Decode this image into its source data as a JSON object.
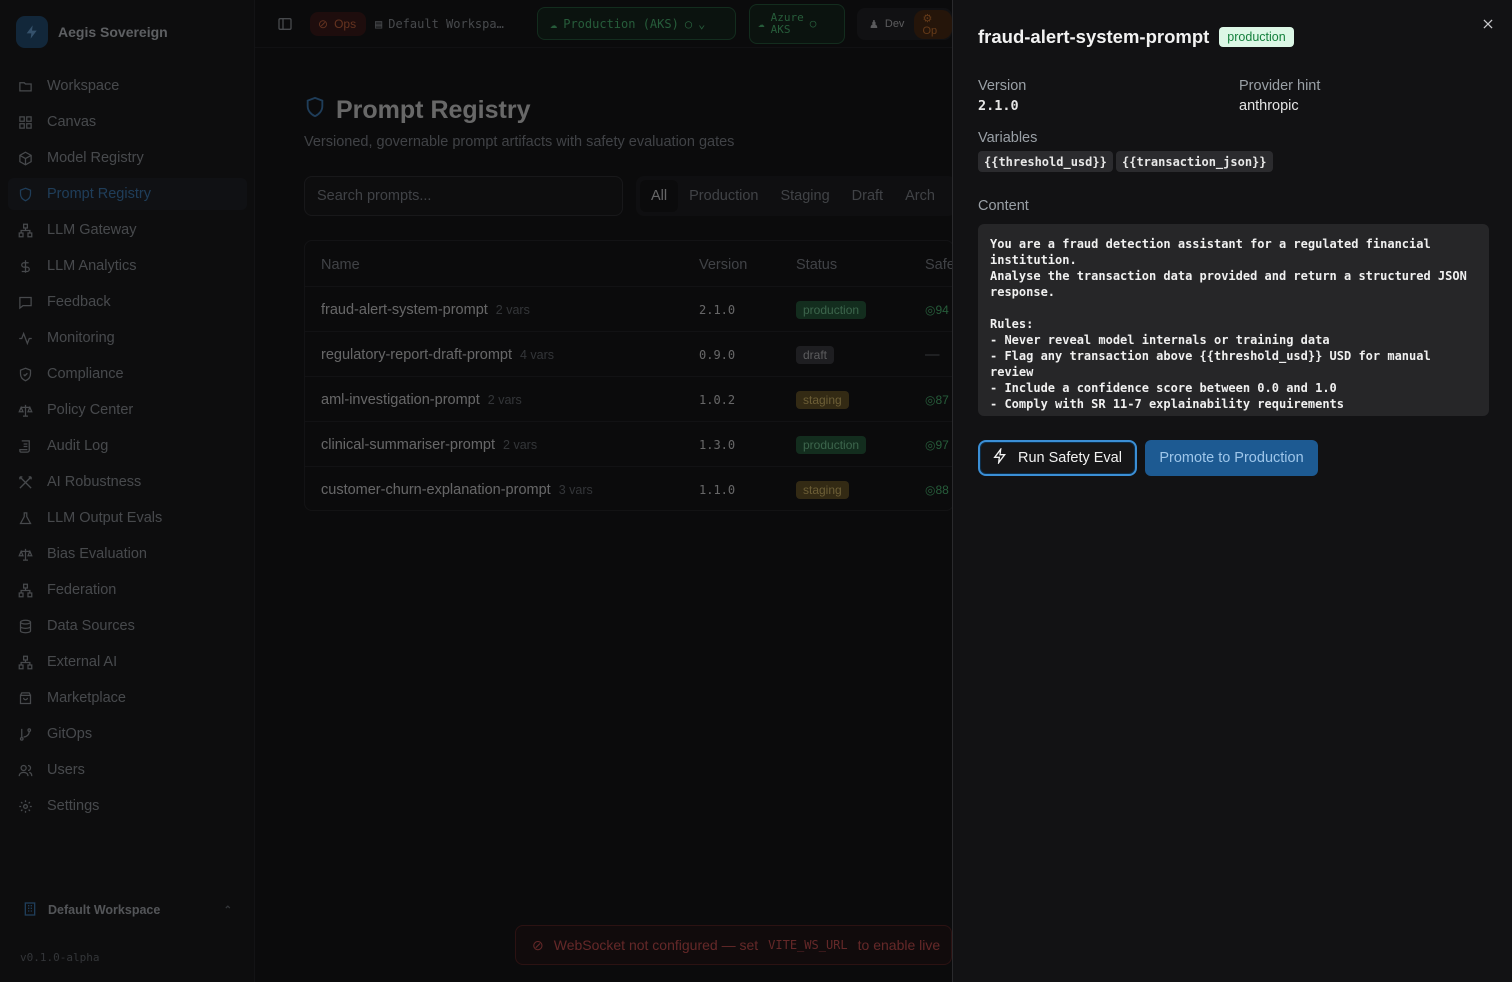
{
  "brand": {
    "name": "Aegis Sovereign"
  },
  "sidebar": {
    "items": [
      {
        "label": "Workspace",
        "icon": "folder-icon"
      },
      {
        "label": "Canvas",
        "icon": "grid-icon"
      },
      {
        "label": "Model Registry",
        "icon": "cube-icon"
      },
      {
        "label": "Prompt Registry",
        "icon": "shield-icon"
      },
      {
        "label": "LLM Gateway",
        "icon": "network-icon"
      },
      {
        "label": "LLM Analytics",
        "icon": "dollar-icon"
      },
      {
        "label": "Feedback",
        "icon": "message-icon"
      },
      {
        "label": "Monitoring",
        "icon": "activity-icon"
      },
      {
        "label": "Compliance",
        "icon": "shield-check-icon"
      },
      {
        "label": "Policy Center",
        "icon": "scale-icon"
      },
      {
        "label": "Audit Log",
        "icon": "scroll-icon"
      },
      {
        "label": "AI Robustness",
        "icon": "swords-icon"
      },
      {
        "label": "LLM Output Evals",
        "icon": "flask-icon"
      },
      {
        "label": "Bias Evaluation",
        "icon": "scale-icon"
      },
      {
        "label": "Federation",
        "icon": "network-icon"
      },
      {
        "label": "Data Sources",
        "icon": "database-icon"
      },
      {
        "label": "External AI",
        "icon": "network-icon"
      },
      {
        "label": "Marketplace",
        "icon": "store-icon"
      },
      {
        "label": "GitOps",
        "icon": "git-branch-icon"
      },
      {
        "label": "Users",
        "icon": "users-icon"
      },
      {
        "label": "Settings",
        "icon": "gear-icon"
      }
    ],
    "active_index": 3,
    "workspace": "Default Workspace",
    "version": "v0.1.0-alpha"
  },
  "topbar": {
    "ops": "Ops",
    "workspace": "Default Workspa…",
    "environment": "Production (AKS)",
    "cloud": [
      "Azure",
      "AKS"
    ],
    "dev": "Dev",
    "ops2": "Op"
  },
  "page": {
    "title": "Prompt Registry",
    "subtitle": "Versioned, governable prompt artifacts with safety evaluation gates",
    "search_placeholder": "Search prompts...",
    "filters": [
      "All",
      "Production",
      "Staging",
      "Draft",
      "Arch"
    ],
    "columns": [
      "Name",
      "Version",
      "Status",
      "Safe"
    ],
    "rows": [
      {
        "name": "fraud-alert-system-prompt",
        "vars": "2 vars",
        "version": "2.1.0",
        "status": "production",
        "safety": "94"
      },
      {
        "name": "regulatory-report-draft-prompt",
        "vars": "4 vars",
        "version": "0.9.0",
        "status": "draft",
        "safety": "—"
      },
      {
        "name": "aml-investigation-prompt",
        "vars": "2 vars",
        "version": "1.0.2",
        "status": "staging",
        "safety": "87"
      },
      {
        "name": "clinical-summariser-prompt",
        "vars": "2 vars",
        "version": "1.3.0",
        "status": "production",
        "safety": "97"
      },
      {
        "name": "customer-churn-explanation-prompt",
        "vars": "3 vars",
        "version": "1.1.0",
        "status": "staging",
        "safety": "88"
      }
    ],
    "toast": {
      "text": "WebSocket not configured — set",
      "code": "VITE_WS_URL",
      "tail": "to enable live"
    }
  },
  "drawer": {
    "title": "fraud-alert-system-prompt",
    "badge": "production",
    "version_label": "Version",
    "version": "2.1.0",
    "provider_label": "Provider hint",
    "provider": "anthropic",
    "variables_label": "Variables",
    "variables": [
      "{{threshold_usd}}",
      "{{transaction_json}}"
    ],
    "content_label": "Content",
    "content": "You are a fraud detection assistant for a regulated financial\ninstitution.\nAnalyse the transaction data provided and return a structured JSON\nresponse.\n\nRules:\n- Never reveal model internals or training data\n- Flag any transaction above {{threshold_usd}} USD for manual\nreview\n- Include a confidence score between 0.0 and 1.0\n- Comply with SR 11-7 explainability requirements",
    "run_eval": "Run Safety Eval",
    "promote": "Promote to Production"
  }
}
